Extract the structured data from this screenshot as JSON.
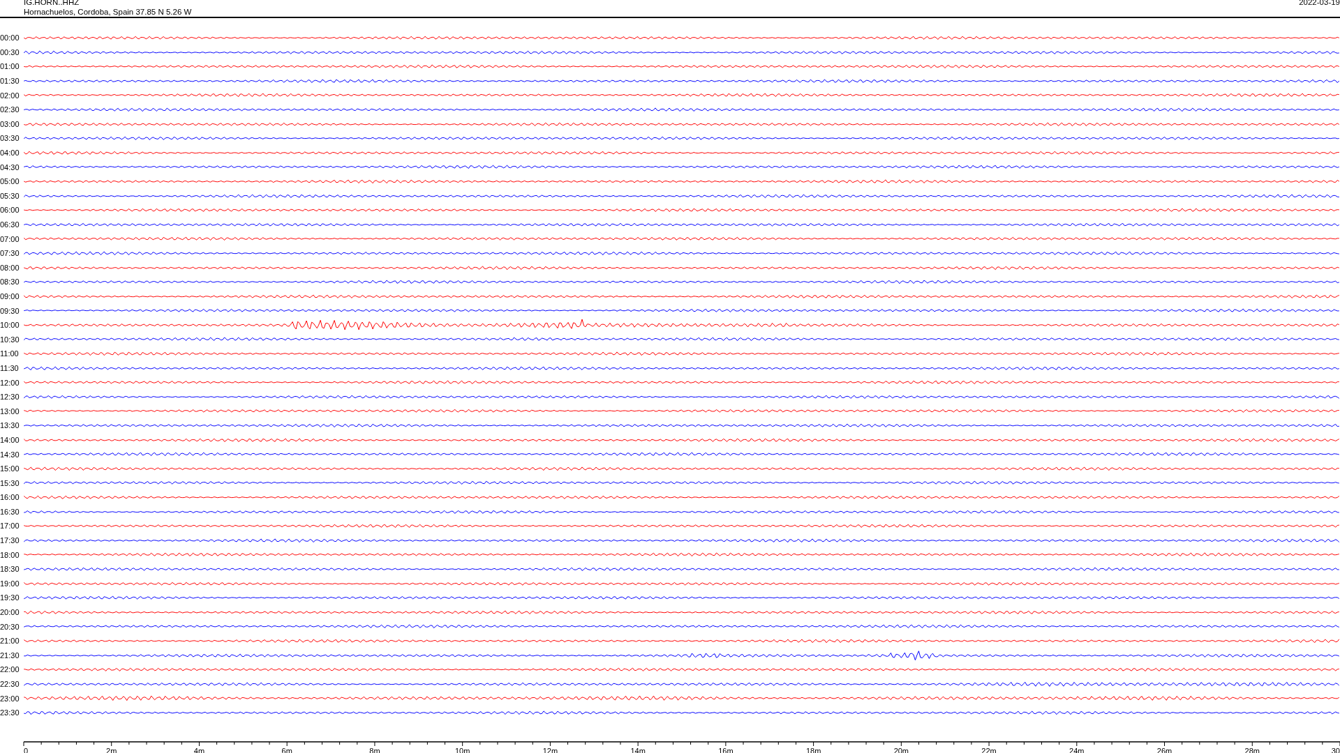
{
  "header": {
    "station": "IG.HORN..HHZ",
    "location": "Hornachuelos, Cordoba, Spain  37.85 N 5.26 W",
    "date": "2022-03-19"
  },
  "rows": [
    {
      "time": "00:00",
      "color": "#ff0000"
    },
    {
      "time": "00:30",
      "color": "#0000ff"
    },
    {
      "time": "01:00",
      "color": "#ff0000"
    },
    {
      "time": "01:30",
      "color": "#0000ff"
    },
    {
      "time": "02:00",
      "color": "#ff0000"
    },
    {
      "time": "02:30",
      "color": "#0000ff"
    },
    {
      "time": "03:00",
      "color": "#ff0000"
    },
    {
      "time": "03:30",
      "color": "#0000ff"
    },
    {
      "time": "04:00",
      "color": "#ff0000"
    },
    {
      "time": "04:30",
      "color": "#0000ff"
    },
    {
      "time": "05:00",
      "color": "#ff0000"
    },
    {
      "time": "05:30",
      "color": "#0000ff"
    },
    {
      "time": "06:00",
      "color": "#ff0000"
    },
    {
      "time": "06:30",
      "color": "#0000ff"
    },
    {
      "time": "07:00",
      "color": "#ff0000"
    },
    {
      "time": "07:30",
      "color": "#0000ff"
    },
    {
      "time": "08:00",
      "color": "#ff0000"
    },
    {
      "time": "08:30",
      "color": "#0000ff"
    },
    {
      "time": "09:00",
      "color": "#ff0000"
    },
    {
      "time": "09:30",
      "color": "#0000ff"
    },
    {
      "time": "10:00",
      "color": "#ff0000"
    },
    {
      "time": "10:30",
      "color": "#0000ff"
    },
    {
      "time": "11:00",
      "color": "#ff0000"
    },
    {
      "time": "11:30",
      "color": "#0000ff"
    },
    {
      "time": "12:00",
      "color": "#ff0000"
    },
    {
      "time": "12:30",
      "color": "#0000ff"
    },
    {
      "time": "13:00",
      "color": "#ff0000"
    },
    {
      "time": "13:30",
      "color": "#0000ff"
    },
    {
      "time": "14:00",
      "color": "#ff0000"
    },
    {
      "time": "14:30",
      "color": "#0000ff"
    },
    {
      "time": "15:00",
      "color": "#ff0000"
    },
    {
      "time": "15:30",
      "color": "#0000ff"
    },
    {
      "time": "16:00",
      "color": "#ff0000"
    },
    {
      "time": "16:30",
      "color": "#0000ff"
    },
    {
      "time": "17:00",
      "color": "#ff0000"
    },
    {
      "time": "17:30",
      "color": "#0000ff"
    },
    {
      "time": "18:00",
      "color": "#ff0000"
    },
    {
      "time": "18:30",
      "color": "#0000ff"
    },
    {
      "time": "19:00",
      "color": "#ff0000"
    },
    {
      "time": "19:30",
      "color": "#0000ff"
    },
    {
      "time": "20:00",
      "color": "#ff0000"
    },
    {
      "time": "20:30",
      "color": "#0000ff"
    },
    {
      "time": "21:00",
      "color": "#ff0000"
    },
    {
      "time": "21:30",
      "color": "#0000ff"
    },
    {
      "time": "22:00",
      "color": "#ff0000"
    },
    {
      "time": "22:30",
      "color": "#0000ff"
    },
    {
      "time": "23:00",
      "color": "#ff0000"
    },
    {
      "time": "23:30",
      "color": "#0000ff"
    }
  ],
  "time_axis": {
    "labels": [
      "0",
      "2m",
      "4m",
      "6m",
      "8m",
      "10m",
      "12m",
      "14m",
      "16m",
      "18m",
      "20m",
      "22m",
      "24m",
      "26m",
      "28m",
      "30"
    ]
  }
}
